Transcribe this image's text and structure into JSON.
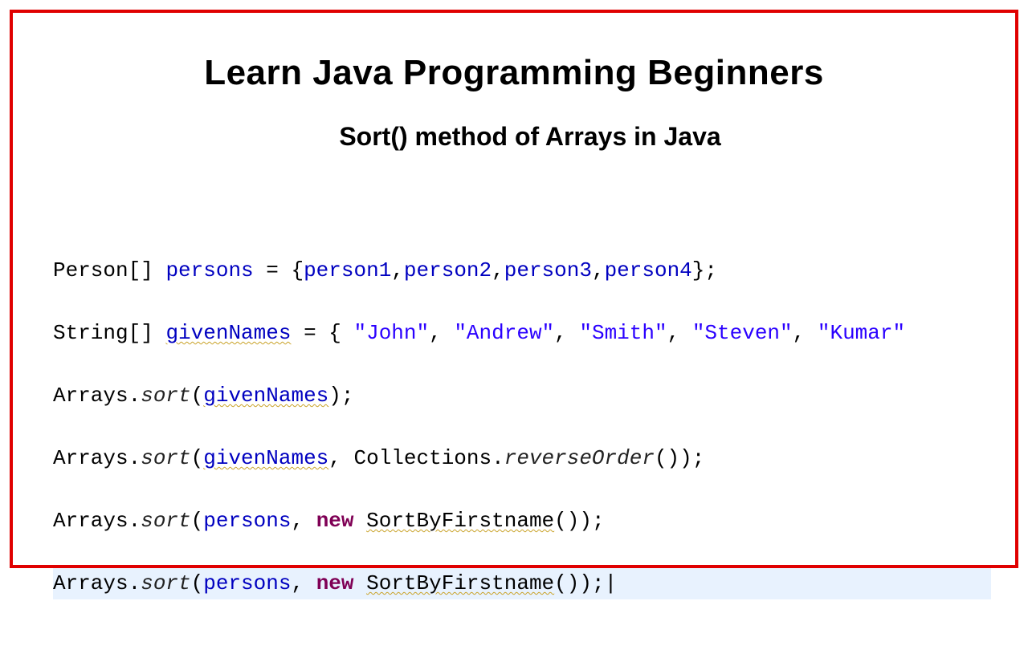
{
  "title": "Learn Java Programming Beginners",
  "subtitle": "Sort() method of Arrays in Java",
  "code": {
    "l1": {
      "type": "Person[] ",
      "var": "persons",
      "eq": " = {",
      "p1": "person1",
      "c1": ",",
      "p2": "person2",
      "c2": ",",
      "p3": "person3",
      "c3": ",",
      "p4": "person4",
      "end": "};"
    },
    "l2": {
      "type": "String[] ",
      "var": "givenNames",
      "eq": " = { ",
      "s1": "\"John\"",
      "c1": ", ",
      "s2": "\"Andrew\"",
      "c2": ", ",
      "s3": "\"Smith\"",
      "c3": ", ",
      "s4": "\"Steven\"",
      "c4": ", ",
      "s5": "\"Kumar\""
    },
    "l3": {
      "cls": "Arrays.",
      "m": "sort",
      "open": "(",
      "arg": "givenNames",
      "close": ");"
    },
    "l4": {
      "cls": "Arrays.",
      "m": "sort",
      "open": "(",
      "arg": "givenNames",
      "c1": ", Collections.",
      "m2": "reverseOrder",
      "close": "());"
    },
    "l5": {
      "cls": "Arrays.",
      "m": "sort",
      "open": "(",
      "arg": "persons",
      "c1": ", ",
      "kw": "new",
      "sp": " ",
      "klass": "SortByFirstname",
      "close": "());"
    },
    "l6": {
      "cls": "Arrays.",
      "m": "sort",
      "open": "(",
      "arg": "persons",
      "c1": ", ",
      "kw": "new",
      "sp": " ",
      "klass": "SortByFirstname",
      "close": "());",
      "cursor": "|"
    }
  }
}
